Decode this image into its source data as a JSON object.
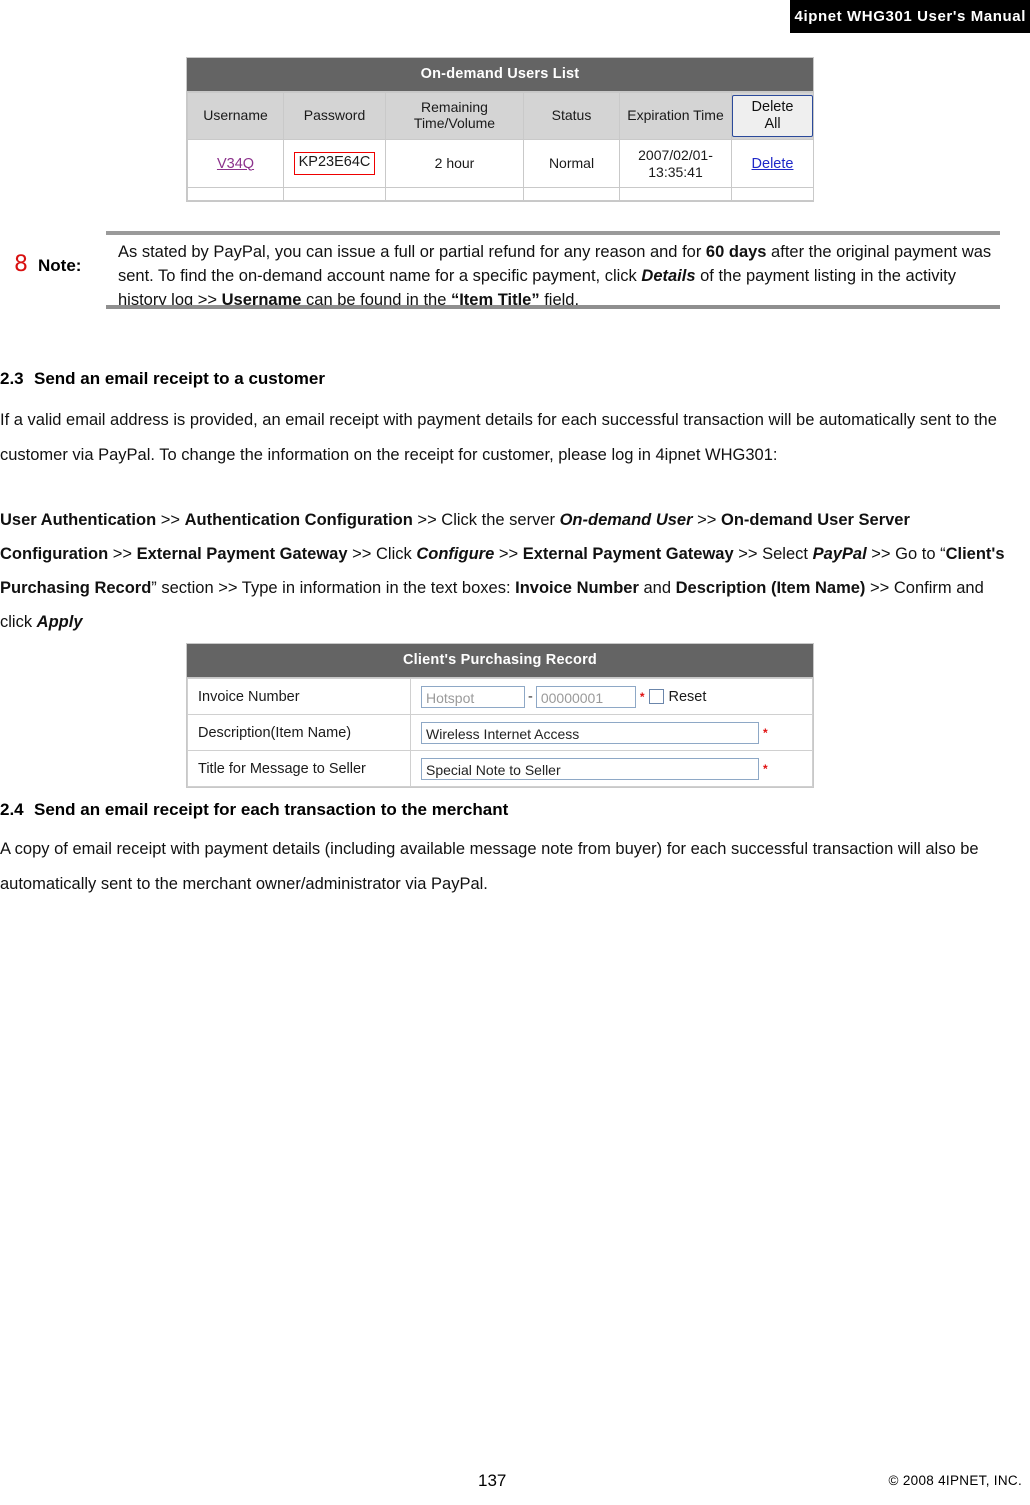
{
  "header": {
    "running_title": "4ipnet WHG301 User's Manual"
  },
  "users_list": {
    "title": "On-demand Users List",
    "columns": [
      "Username",
      "Password",
      "Remaining Time/Volume",
      "Status",
      "Expiration Time"
    ],
    "delete_all_label": "Delete All",
    "rows": [
      {
        "username": "V34Q",
        "password": "KP23E64C",
        "remaining": "2 hour",
        "status": "Normal",
        "expiration": "2007/02/01-13:35:41",
        "delete_label": "Delete"
      }
    ]
  },
  "note": {
    "icon": "hand-pointer-icon",
    "icon_glyph": "8",
    "label": "Note:",
    "line1_a": "As stated by PayPal, you can issue a full or partial refund for any reason and for ",
    "line1_bold": "60 days",
    "line1_b": " after the original payment was sent. To find the on-demand account name for a specific payment, click ",
    "line1_bolditalic": "Details",
    "line2_a": " of the payment listing in the activity history log >> ",
    "line2_bold": "Username",
    "line2_b": " can be found in the ",
    "line2_bold2": "“Item Title”",
    "line2_c": " field."
  },
  "section_23": {
    "number": "2.3",
    "title": "Send an email receipt to a customer",
    "paragraph": "If a valid email address is provided, an email receipt with payment details for each successful transaction will be automatically sent to the customer via PayPal. To change the information on the receipt for customer, please log in 4ipnet WHG301:",
    "path": {
      "p1": "User Authentication",
      "sep1": " >> ",
      "p2": "Authentication Configuration",
      "sep2": " >> ",
      "t1": "Click the server ",
      "p3": "On-demand User",
      "sep3": " >> ",
      "p4": "On-demand User Server Configuration",
      "sep4": " >> ",
      "p5": "External Payment Gateway",
      "sep5": " >> ",
      "t2": "Click ",
      "p6": "Configure",
      "sep6": " >> ",
      "p7": "External Payment Gateway",
      "sep7": " >> ",
      "t3": "Select ",
      "p8": "PayPal",
      "sep8": " >> ",
      "t4": "Go to “",
      "p9": "Client's Purchasing Record",
      "t5": "” section >> Type in information in the text boxes: ",
      "p10": "Invoice Number",
      "t6": " and ",
      "p11": "Description (Item Name)",
      "sep9": " >> ",
      "t7": "Confirm and click ",
      "p12": "Apply"
    }
  },
  "purchasing_record": {
    "title": "Client's Purchasing Record",
    "rows": [
      {
        "label": "Invoice Number",
        "prefix_value": "Hotspot",
        "separator": "-",
        "serial_value": "00000001",
        "required_mark": "*",
        "reset_label": "Reset",
        "reset_checked": false
      },
      {
        "label": "Description(Item Name)",
        "value": "Wireless Internet Access",
        "required_mark": "*"
      },
      {
        "label": "Title for Message to Seller",
        "value": "Special Note to Seller",
        "required_mark": "*"
      }
    ]
  },
  "section_24": {
    "number": "2.4",
    "title": "Send an email receipt for each transaction to the merchant",
    "paragraph": "A copy of email receipt with payment details (including available message note from buyer) for each successful transaction will also be automatically sent to the merchant owner/administrator via PayPal."
  },
  "footer": {
    "page_number": "137",
    "copyright": "© 2008 4IPNET, INC."
  },
  "colors": {
    "header_bar": "#000000",
    "table_title_bar": "#646464",
    "table_head_cell": "#d4d4d4",
    "username_link": "#8c328c",
    "delete_link": "#1f28c8",
    "highlight_box": "#ee0000",
    "required_asterisk": "#e01010",
    "note_rule": "#9a9a9a",
    "note_icon": "#d81010",
    "input_border": "#8ea8c6"
  }
}
